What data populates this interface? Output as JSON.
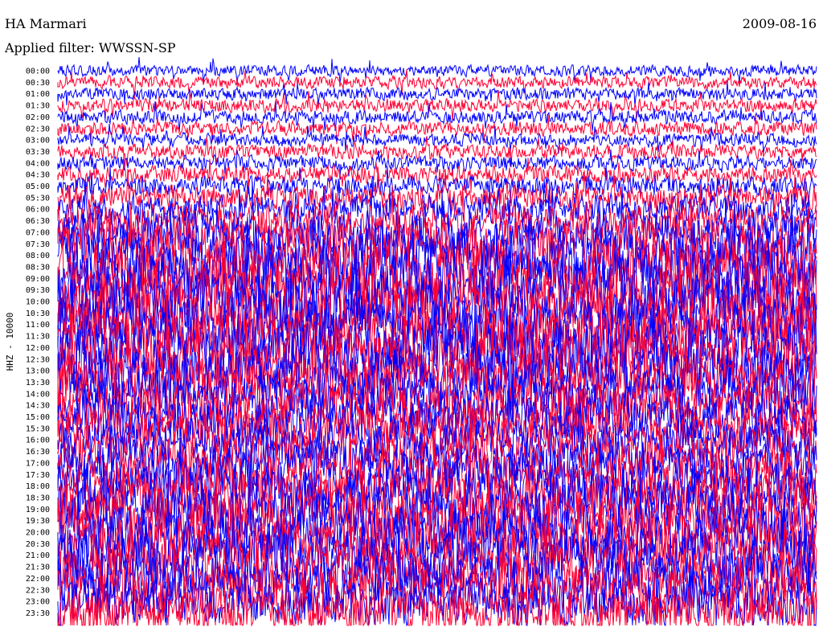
{
  "header": {
    "station": "HA Marmari",
    "date": "2009-08-16",
    "filter": "Applied filter: WWSSN-SP"
  },
  "chart_data": {
    "type": "line",
    "title": "HA Marmari",
    "subtitle": "Applied filter: WWSSN-SP",
    "date": "2009-08-16",
    "ylabel": "HHZ - 10000",
    "xlabel": "",
    "row_labels": [
      "00:00",
      "00:30",
      "01:00",
      "01:30",
      "02:00",
      "02:30",
      "03:00",
      "03:30",
      "04:00",
      "04:30",
      "05:00",
      "05:30",
      "06:00",
      "06:30",
      "07:00",
      "07:30",
      "08:00",
      "08:30",
      "09:00",
      "09:30",
      "10:00",
      "10:30",
      "11:00",
      "11:30",
      "12:00",
      "12:30",
      "13:00",
      "13:30",
      "14:00",
      "14:30",
      "15:00",
      "15:30",
      "16:00",
      "16:30",
      "17:00",
      "17:30",
      "18:00",
      "18:30",
      "19:00",
      "19:30",
      "20:00",
      "20:30",
      "21:00",
      "21:30",
      "22:00",
      "22:30",
      "23:00",
      "23:30"
    ],
    "series_colors": [
      "#0000ff",
      "#ff0033"
    ],
    "relative_amplitude": [
      0.9,
      1.0,
      1.0,
      1.1,
      1.1,
      1.2,
      1.1,
      1.2,
      1.2,
      1.4,
      1.6,
      1.9,
      2.3,
      2.7,
      3.4,
      4.0,
      4.3,
      4.5,
      4.6,
      4.6,
      4.7,
      4.6,
      4.6,
      4.5,
      4.4,
      4.3,
      4.2,
      4.0,
      3.8,
      3.6,
      3.5,
      3.3,
      3.2,
      3.3,
      3.5,
      3.7,
      3.9,
      4.0,
      4.1,
      4.1,
      4.2,
      4.2,
      4.2,
      4.1,
      4.0,
      3.9,
      3.8,
      3.6
    ],
    "grid": false,
    "legend": "none"
  }
}
